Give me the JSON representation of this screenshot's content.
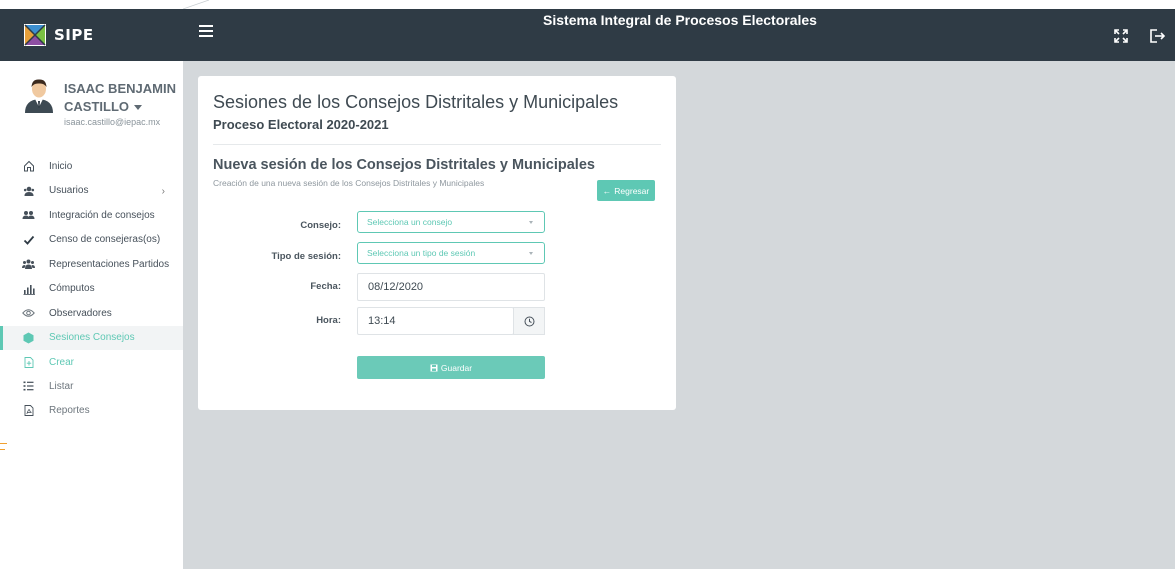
{
  "app": {
    "brand": "SIPE",
    "title": "Sistema Integral de Procesos Electorales"
  },
  "user": {
    "name": "ISAAC BENJAMIN CASTILLO",
    "email": "isaac.castillo@iepac.mx"
  },
  "sidebar": {
    "items": [
      {
        "label": "Inicio",
        "icon": "home-icon"
      },
      {
        "label": "Usuarios",
        "icon": "users-icon"
      },
      {
        "label": "Integración de consejos",
        "icon": "group-icon"
      },
      {
        "label": "Censo de consejeras(os)",
        "icon": "check-icon"
      },
      {
        "label": "Representaciones Partidos",
        "icon": "people-icon"
      },
      {
        "label": "Cómputos",
        "icon": "bar-chart-icon"
      },
      {
        "label": "Observadores",
        "icon": "eye-icon"
      },
      {
        "label": "Sesiones Consejos",
        "icon": "hexagon-icon"
      }
    ],
    "subitems": [
      {
        "label": "Crear",
        "icon": "create-icon"
      },
      {
        "label": "Listar",
        "icon": "list-icon"
      },
      {
        "label": "Reportes",
        "icon": "pdf-icon"
      }
    ]
  },
  "page": {
    "title": "Sesiones de los Consejos Distritales y Municipales",
    "subtitle": "Proceso Electoral 2020-2021",
    "section_title": "Nueva sesión de los Consejos Distritales y Municipales",
    "section_desc": "Creación de una nueva sesión de los Consejos Distritales y Municipales",
    "back_button": "Regresar"
  },
  "form": {
    "consejo_label": "Consejo:",
    "consejo_placeholder": "Selecciona un consejo",
    "tipo_label": "Tipo de sesión:",
    "tipo_placeholder": "Selecciona un tipo de sesión",
    "fecha_label": "Fecha:",
    "fecha_value": "08/12/2020",
    "hora_label": "Hora:",
    "hora_value": "13:14",
    "save_button": "Guardar"
  },
  "colors": {
    "header_bg": "#2f3b45",
    "accent": "#5ec8b4",
    "canvas": "#d4d8db"
  }
}
